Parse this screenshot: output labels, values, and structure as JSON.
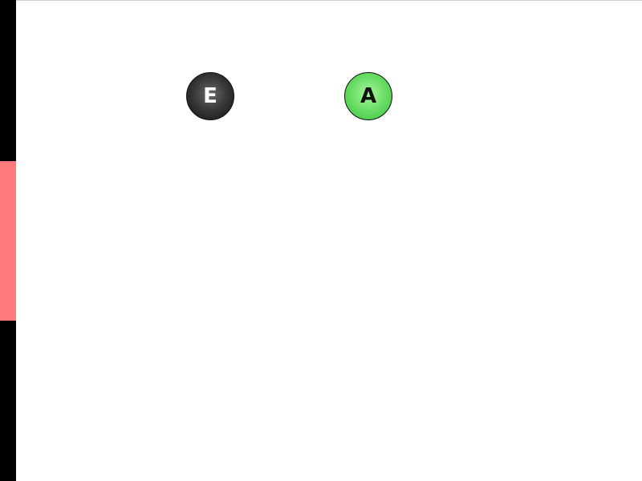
{
  "nodes": [
    {
      "id": "e",
      "label": "E",
      "color": "#1a1a1a",
      "text_color": "#ffffff"
    },
    {
      "id": "a",
      "label": "A",
      "color": "#5fd85c",
      "text_color": "#111111"
    }
  ],
  "left_bar": {
    "base_color": "#000000",
    "highlight_color": "#ff7a7a"
  },
  "background_color": "#ffffff"
}
